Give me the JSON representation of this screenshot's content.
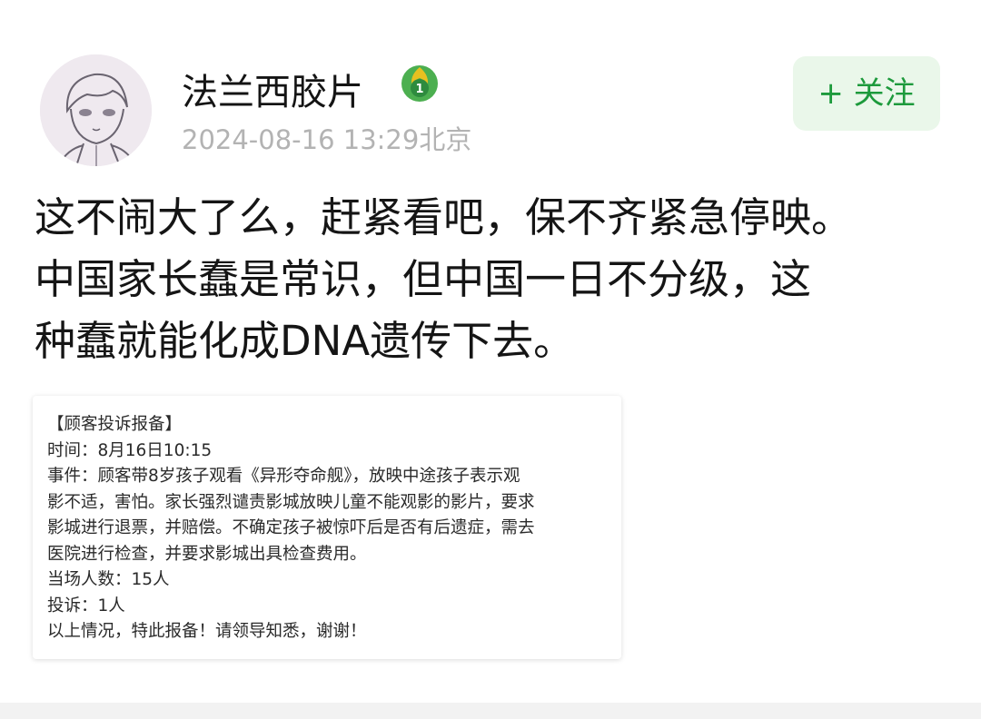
{
  "author": {
    "name": "法兰西胶片",
    "level": "1",
    "date": "2024-08-16 13:29",
    "location": "北京"
  },
  "actions": {
    "follow_label": "+ 关注"
  },
  "post": {
    "lines": [
      "这不闹大了么，赶紧看吧，保不齐紧急停映。",
      "中国家长蠢是常识，但中国一日不分级，这",
      "种蠢就能化成DNA遗传下去。"
    ]
  },
  "attachment": {
    "lines": [
      "【顾客投诉报备】",
      "时间：8月16日10:15",
      "事件：顾客带8岁孩子观看《异形夺命舰》，放映中途孩子表示观",
      "影不适，害怕。家长强烈谴责影城放映儿童不能观影的影片，要求",
      "影城进行退票，并赔偿。不确定孩子被惊吓后是否有后遗症，需去",
      "医院进行检查，并要求影城出具检查费用。",
      "当场人数：15人",
      "投诉：1人",
      "以上情况，特此报备！请领导知悉，谢谢！"
    ]
  },
  "colors": {
    "follow_text": "#1d9a3c",
    "follow_bg": "#eaf7ea",
    "meta_text": "#b3b3b3",
    "badge_green": "#4caf50",
    "badge_flame": "#e8c020"
  }
}
